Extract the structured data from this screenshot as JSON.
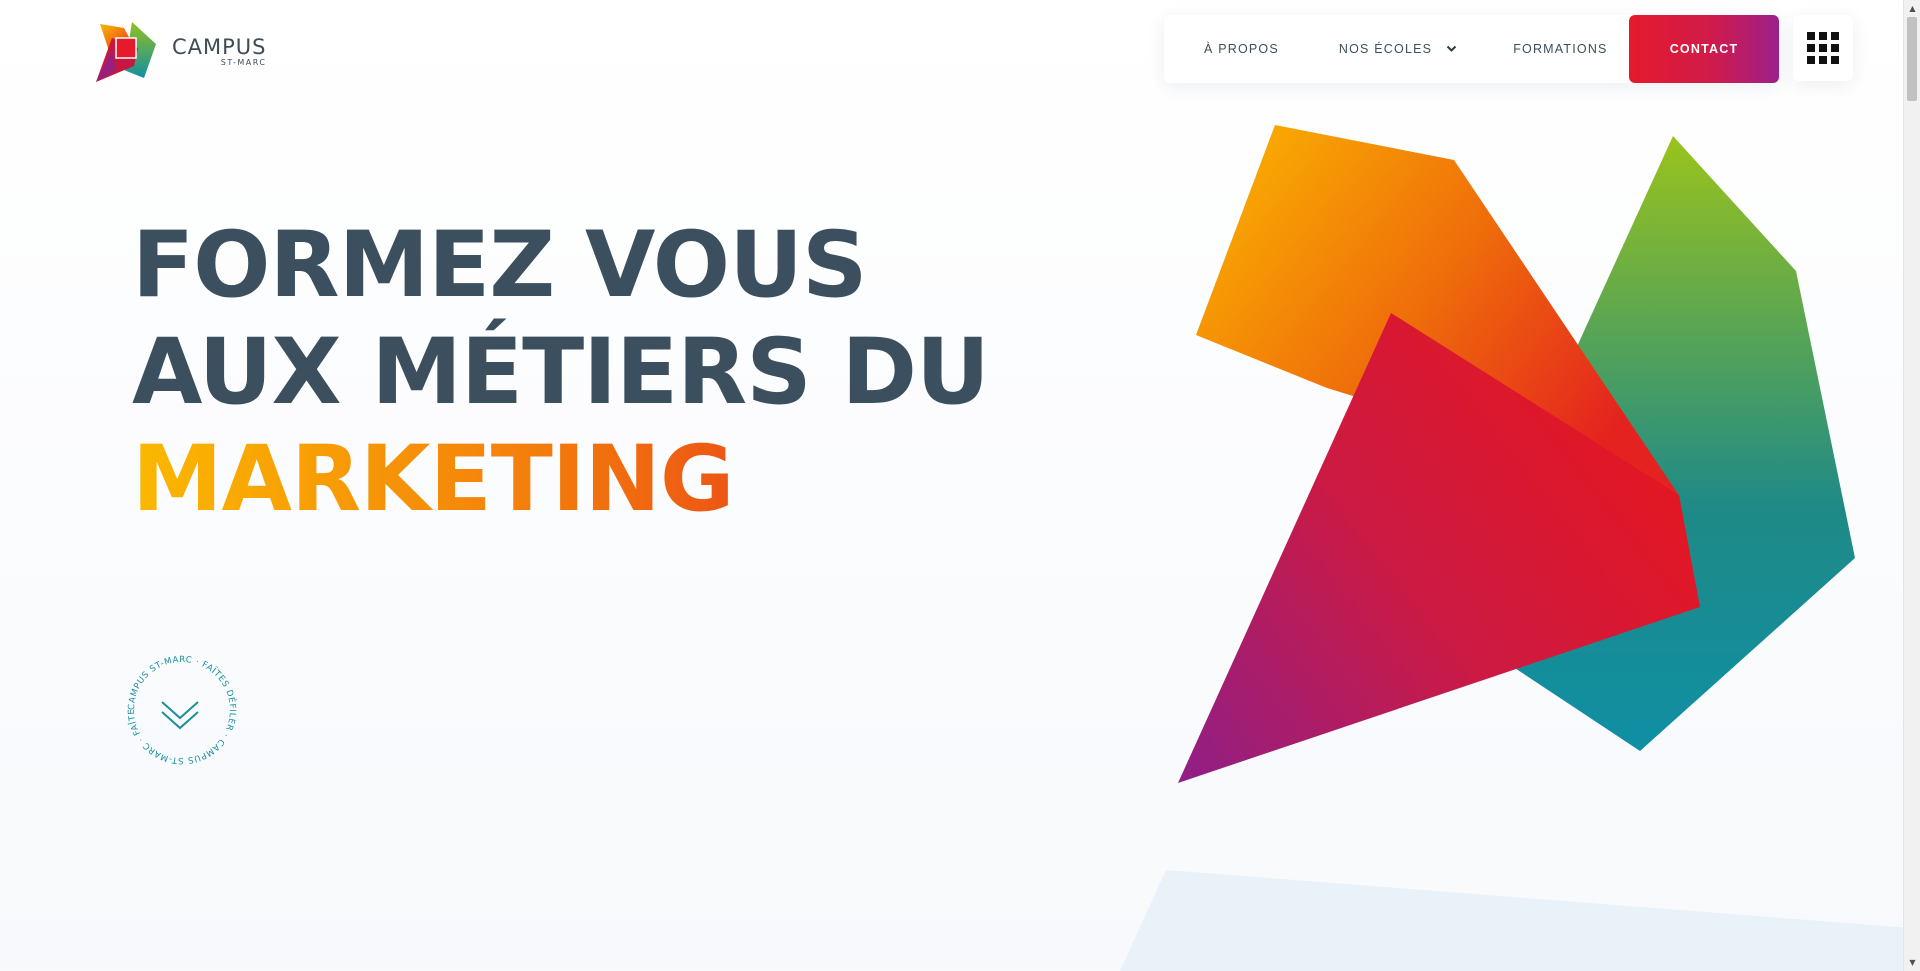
{
  "brand": {
    "logo_word": "CAMPUS",
    "logo_sub": "ST-MARC",
    "logo_badge": "C SM"
  },
  "nav": {
    "about": "À PROPOS",
    "schools": "NOS ÉCOLES",
    "formations": "FORMATIONS",
    "contact": "CONTACT"
  },
  "hero": {
    "line1": "FORMEZ VOUS",
    "line2": "AUX MÉTIERS DU",
    "line3": "MARKETING"
  },
  "scroll_badge": {
    "ring_text": "CAMPUS ST-MARC · FAÎTES DÉFILER · CAMPUS ST-MARC · FAÎTES DÉFILER ·"
  },
  "colors": {
    "heading": "#3c4f5e",
    "accent_start": "#fbb800",
    "accent_end": "#e4221f",
    "contact_start": "#e51a2d",
    "contact_end": "#9c2089",
    "teal": "#1a8fa0"
  },
  "icons": {
    "schools_dropdown": "chevron-down-icon",
    "apps_menu": "grid-menu-icon",
    "scroll_down": "double-chevron-down-icon"
  }
}
